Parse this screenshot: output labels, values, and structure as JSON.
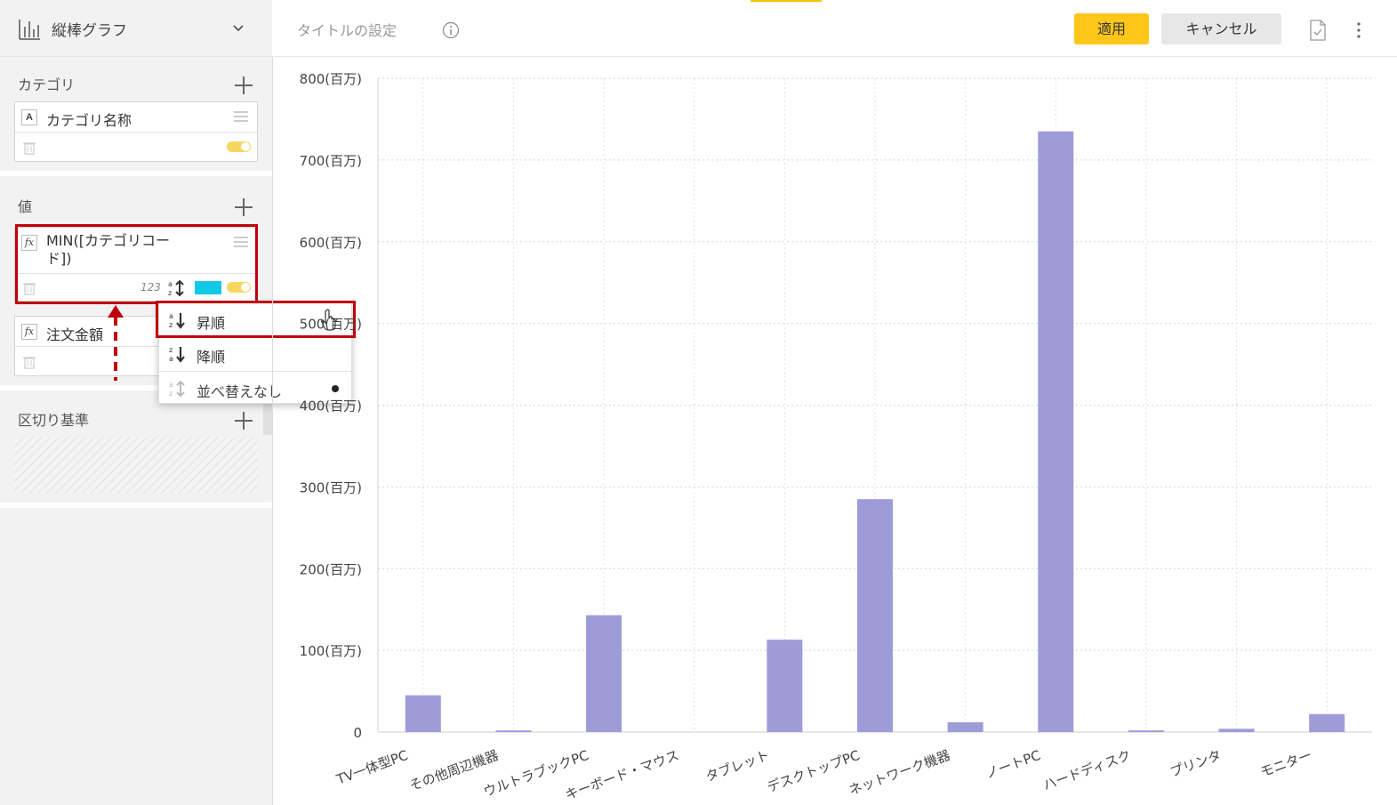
{
  "chart_type_selector": {
    "label": "縦棒グラフ"
  },
  "sections": {
    "category": {
      "title": "カテゴリ",
      "field": {
        "badge": "A",
        "label": "カテゴリ名称"
      }
    },
    "values": {
      "title": "値",
      "fields": [
        {
          "badge": "fx",
          "label_line1": "MIN([カテゴリコー",
          "label_line2": "ド])",
          "format": "123"
        },
        {
          "badge": "fx",
          "label": "注文金額"
        }
      ]
    },
    "split": {
      "title": "区切り基準"
    }
  },
  "sort_menu": {
    "items": [
      {
        "label": "昇順",
        "selected": false
      },
      {
        "label": "降順",
        "selected": false
      },
      {
        "label": "並べ替えなし",
        "selected": true
      }
    ]
  },
  "header": {
    "title_placeholder": "タイトルの設定",
    "apply_label": "適用",
    "cancel_label": "キャンセル"
  },
  "colors": {
    "accent": "#ffc61a",
    "bar": "#9e9cd8",
    "highlight": "#c0000b",
    "swatch": "#12c9e5"
  },
  "chart_data": {
    "type": "bar",
    "categories": [
      "TV一体型PC",
      "その他周辺機器",
      "ウルトラブックPC",
      "キーボード・マウス",
      "タブレット",
      "デスクトップPC",
      "ネットワーク機器",
      "ノートPC",
      "ハードディスク",
      "プリンタ",
      "モニター"
    ],
    "values": [
      45,
      2,
      143,
      0,
      113,
      285,
      12,
      735,
      2,
      4,
      22
    ],
    "ylim": [
      0,
      800
    ],
    "yticks": [
      0,
      100,
      200,
      300,
      400,
      500,
      600,
      700,
      800
    ],
    "ytick_labels": [
      "0",
      "100(百万)",
      "200(百万)",
      "300(百万)",
      "400(百万)",
      "500(百万)",
      "600(百万)",
      "700(百万)",
      "800(百万)"
    ],
    "grid": true
  }
}
